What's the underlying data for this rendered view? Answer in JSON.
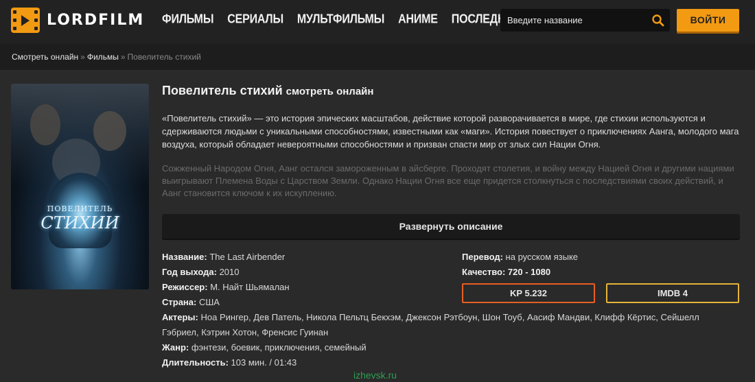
{
  "header": {
    "logo_text": "LORDFILM",
    "nav": [
      "ФИЛЬМЫ",
      "СЕРИАЛЫ",
      "МУЛЬТФИЛЬМЫ",
      "АНИМЕ",
      "ПОСЛЕДНЕЕ"
    ],
    "search_placeholder": "Введите название",
    "login_label": "ВОЙТИ",
    "accent_color": "#f29a12"
  },
  "breadcrumb": {
    "items": [
      "Смотреть онлайн",
      "Фильмы"
    ],
    "current": "Повелитель стихий",
    "separator": "»"
  },
  "poster": {
    "line1": "ПОВЕЛИТЕЛЬ",
    "line2": "СТИХИИ"
  },
  "movie": {
    "title": "Повелитель стихий",
    "title_suffix": "смотреть онлайн",
    "description": "«Повелитель стихий» — это история эпических масштабов, действие которой разворачивается в мире, где стихии используются и сдерживаются людьми с уникальными способностями, известными как «маги». История повествует о приключениях Аанга, молодого мага воздуха, который обладает невероятными способностями и призван спасти мир от злых сил Нации Огня.",
    "description_faded": "Сожженный Народом Огня, Аанг остался замороженным в айсберге. Проходят столетия, и войну между Нацией Огня и другими нациями выигрывают Племена Воды с Царством Земли. Однако Нации Огня все еще придется столкнуться с последствиями своих действий, и Аанг становится ключом к их искуплению.",
    "expand_label": "Развернуть описание",
    "info": [
      {
        "label": "Название:",
        "value": "The Last Airbender"
      },
      {
        "label": "Год выхода:",
        "value": "2010"
      },
      {
        "label": "Режиссер:",
        "value": "М. Найт Шьямалан"
      },
      {
        "label": "Страна:",
        "value": "США"
      },
      {
        "label": "Актеры:",
        "value": "Ноа Рингер, Дев Патель, Никола Пельтц Бекхэм, Джексон Рэтбоун, Шон Тоуб, Аасиф Мандви, Клифф Кёртис, Сейшелл Гэбриел, Кэтрин Хотон, Френсис Гуинан"
      },
      {
        "label": "Жанр:",
        "value": "фэнтези, боевик, приключения, семейный"
      },
      {
        "label": "Длительность:",
        "value": "103 мин. / 01:43"
      }
    ],
    "info_right": [
      {
        "label": "Перевод:",
        "value": "на русском языке"
      },
      {
        "label": "Качество:",
        "value": "720 - 1080"
      }
    ],
    "ratings": {
      "kp": "KP 5.232",
      "imdb": "IMDB 4",
      "kp_color": "#e85f22",
      "imdb_color": "#e6b43a"
    }
  },
  "watermark": "izhevsk.ru"
}
